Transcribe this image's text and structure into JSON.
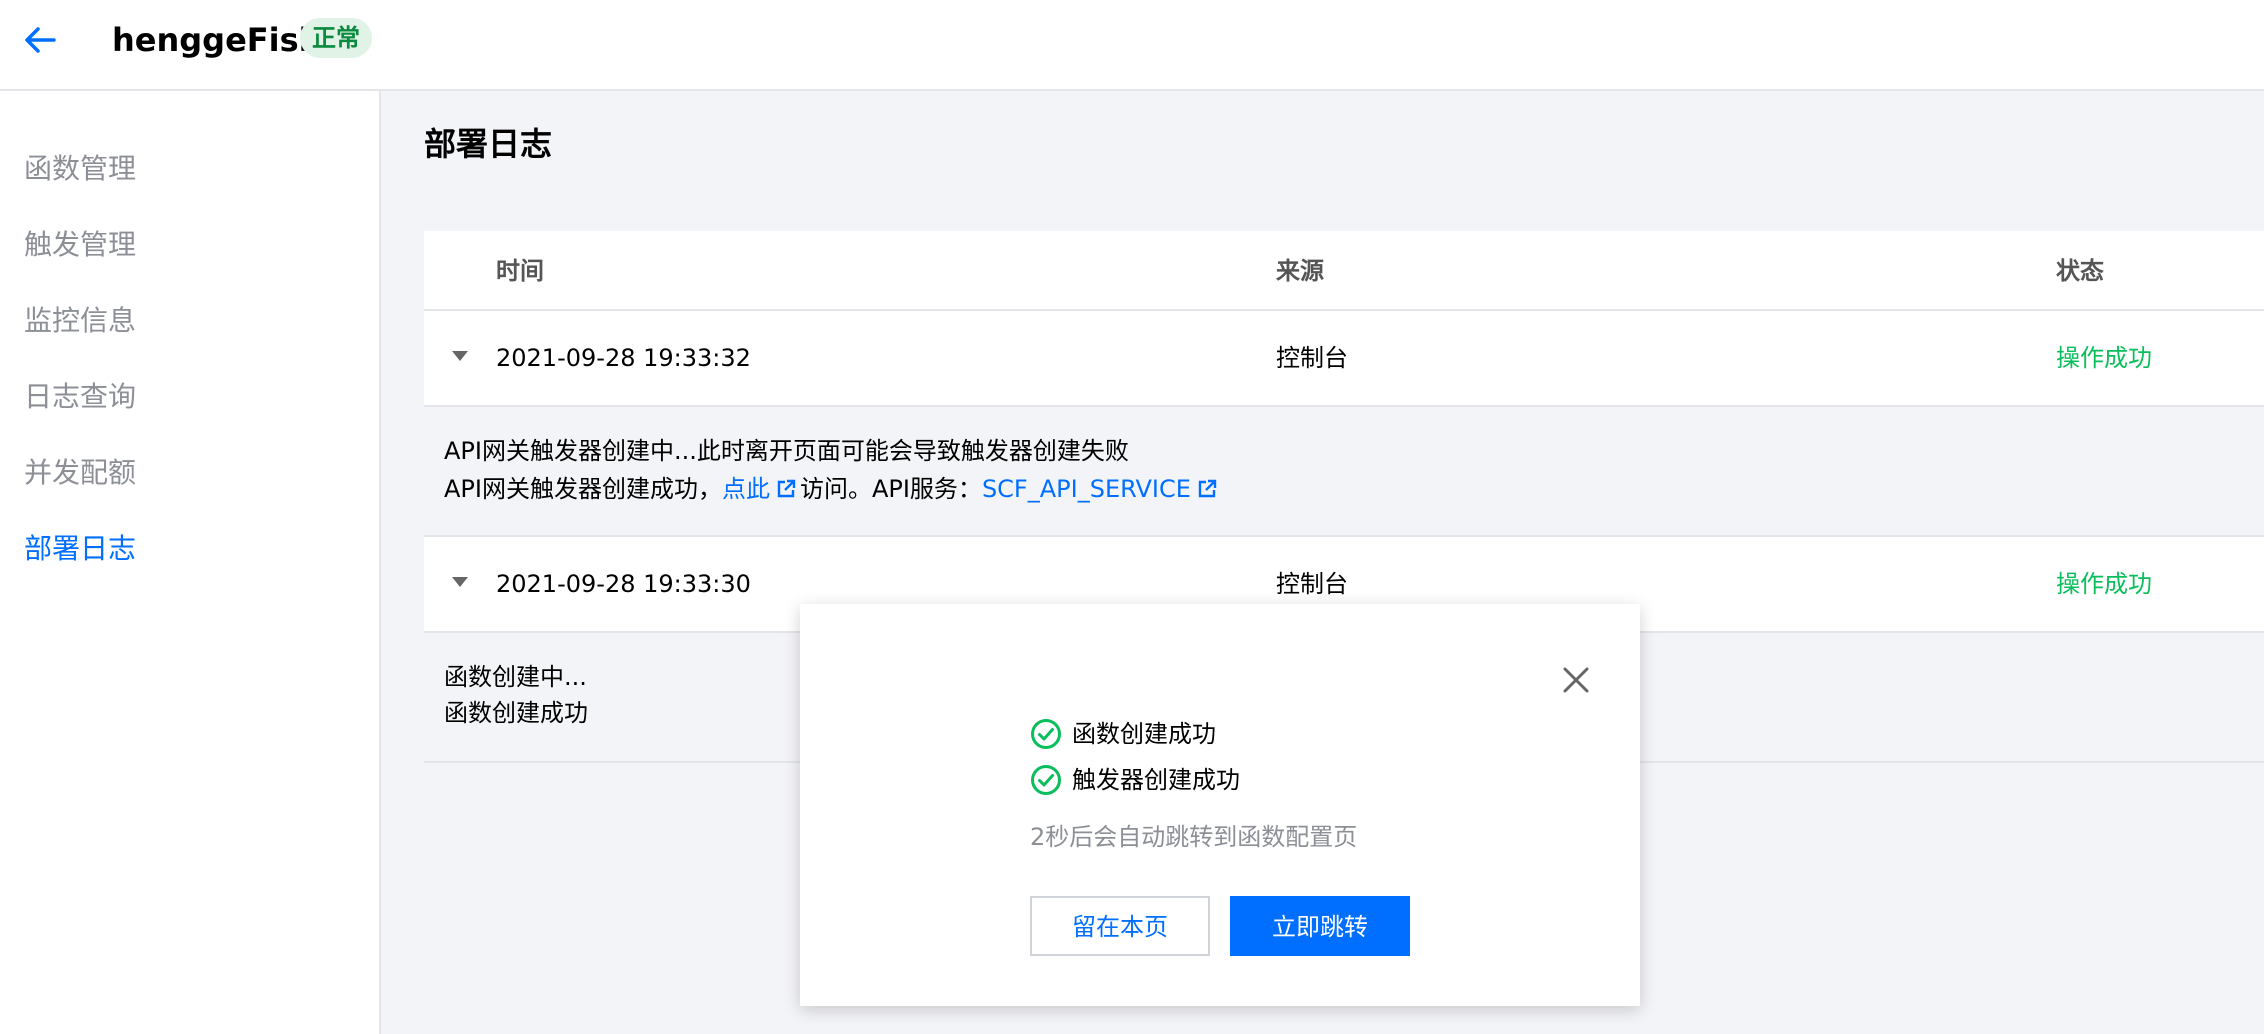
{
  "header": {
    "function_name": "henggeFish",
    "status": "正常"
  },
  "sidebar": {
    "items": [
      {
        "label": "函数管理"
      },
      {
        "label": "触发管理"
      },
      {
        "label": "监控信息"
      },
      {
        "label": "日志查询"
      },
      {
        "label": "并发配额"
      },
      {
        "label": "部署日志"
      }
    ],
    "active": "部署日志"
  },
  "page": {
    "title": "部署日志"
  },
  "table": {
    "columns": [
      "时间",
      "来源",
      "状态"
    ],
    "rows": [
      {
        "time": "2021-09-28 19:33:32",
        "source": "控制台",
        "status": "操作成功",
        "detail": {
          "line1": "API网关触发器创建中...此时离开页面可能会导致触发器创建失败",
          "line2_prefix": "API网关触发器创建成功，",
          "line2_link": "点此",
          "line2_mid": "访问。API服务：",
          "line2_service": "SCF_API_SERVICE"
        }
      },
      {
        "time": "2021-09-28 19:33:30",
        "source": "控制台",
        "status": "操作成功",
        "detail": {
          "line1": "函数创建中...",
          "line2": "函数创建成功"
        }
      }
    ]
  },
  "modal": {
    "messages": [
      "函数创建成功",
      "触发器创建成功"
    ],
    "hint": "2秒后会自动跳转到函数配置页",
    "stay_label": "留在本页",
    "go_label": "立即跳转"
  },
  "colors": {
    "accent": "#006eff",
    "success": "#0abf5b",
    "status_tag_bg": "#e0f3e6"
  }
}
